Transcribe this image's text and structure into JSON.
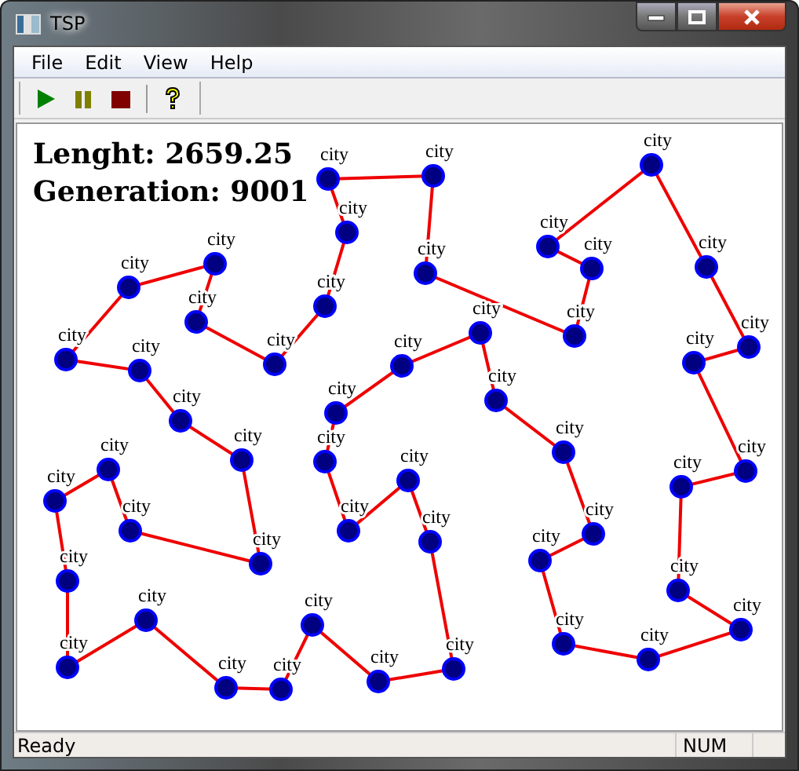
{
  "window": {
    "title": "TSP"
  },
  "menu": [
    "File",
    "Edit",
    "View",
    "Help"
  ],
  "stats": [
    "Lenght: 2659.25",
    "Generation: 9001"
  ],
  "cities": [
    {
      "label": "city"
    },
    {
      "label": "city"
    },
    {
      "label": "city"
    },
    {
      "label": "city"
    },
    {
      "label": "city"
    },
    {
      "label": "city"
    },
    {
      "label": "city"
    },
    {
      "label": "city"
    },
    {
      "label": "city"
    },
    {
      "label": "city"
    },
    {
      "label": "city"
    },
    {
      "label": "city"
    },
    {
      "label": "city"
    },
    {
      "label": "city"
    },
    {
      "label": "city"
    },
    {
      "label": "city"
    },
    {
      "label": "city"
    },
    {
      "label": "city"
    },
    {
      "label": "city"
    },
    {
      "label": "city"
    },
    {
      "label": "city"
    },
    {
      "label": "city"
    },
    {
      "label": "city"
    },
    {
      "label": "city"
    },
    {
      "label": "city"
    },
    {
      "label": "city"
    },
    {
      "label": "city"
    },
    {
      "label": "city"
    },
    {
      "label": "city"
    },
    {
      "label": "city"
    },
    {
      "label": "city"
    },
    {
      "label": "city"
    },
    {
      "label": "city"
    },
    {
      "label": "city"
    },
    {
      "label": "city"
    },
    {
      "label": "city"
    },
    {
      "label": "city"
    },
    {
      "label": "city"
    },
    {
      "label": "city"
    },
    {
      "label": "city"
    },
    {
      "label": "city"
    },
    {
      "label": "city"
    },
    {
      "label": "city"
    },
    {
      "label": "city"
    },
    {
      "label": "city"
    },
    {
      "label": "city"
    },
    {
      "label": "city"
    },
    {
      "label": "city"
    },
    {
      "label": "city"
    }
  ],
  "status_bar": [
    "Ready",
    "NUM"
  ]
}
